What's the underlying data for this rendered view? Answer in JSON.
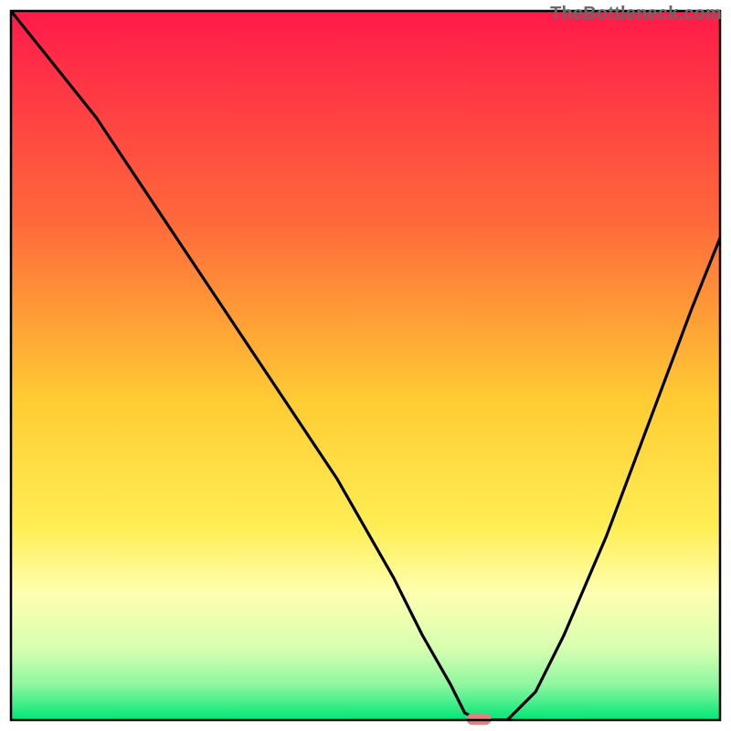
{
  "watermark": "TheBottleneck.com",
  "chart_data": {
    "type": "line",
    "title": "",
    "xlabel": "",
    "ylabel": "",
    "xlim": [
      0,
      100
    ],
    "ylim": [
      0,
      100
    ],
    "grid": false,
    "legend": false,
    "background_gradient": {
      "stops": [
        {
          "offset": 0.0,
          "color": "#ff1a4a"
        },
        {
          "offset": 0.3,
          "color": "#ff6a3a"
        },
        {
          "offset": 0.55,
          "color": "#ffcc33"
        },
        {
          "offset": 0.73,
          "color": "#ffee55"
        },
        {
          "offset": 0.82,
          "color": "#ffffb0"
        },
        {
          "offset": 0.9,
          "color": "#d6ffb0"
        },
        {
          "offset": 0.95,
          "color": "#8ef7a0"
        },
        {
          "offset": 1.0,
          "color": "#00e676"
        }
      ]
    },
    "series": [
      {
        "name": "curve",
        "color": "#000000",
        "x": [
          0,
          12,
          22,
          30,
          38,
          46,
          54,
          58,
          62,
          64,
          66,
          70,
          74,
          78,
          84,
          90,
          96,
          100
        ],
        "y": [
          100,
          85,
          70,
          58,
          46,
          34,
          20,
          12,
          5,
          1,
          0,
          0,
          4,
          12,
          26,
          42,
          58,
          68
        ]
      }
    ],
    "marker": {
      "name": "optimal-marker",
      "x": 66,
      "y": 0,
      "width": 3.5,
      "height": 1.6,
      "color": "#e38282",
      "rx": 1.0
    },
    "frame": {
      "stroke": "#000000",
      "stroke_width": 2.5
    }
  }
}
